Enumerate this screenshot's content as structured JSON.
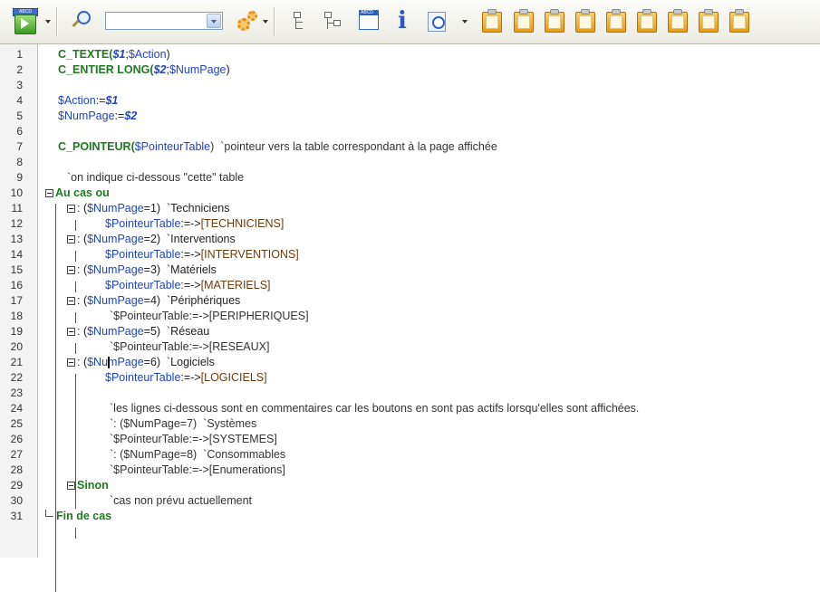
{
  "toolbar": {
    "run_caption": "ABCD",
    "window_caption": "ABCD",
    "method_select_value": "",
    "icons": [
      "run-icon",
      "search-icon",
      "method-list-dropdown",
      "gears-icon",
      "collapse-tree-icon",
      "expand-tree-icon",
      "window-icon",
      "info-icon",
      "timer-icon",
      "clipboard-icon"
    ]
  },
  "editor": {
    "lines": [
      {
        "n": "1",
        "parts": [
          {
            "t": "C_TEXTE(",
            "c": "kw"
          },
          {
            "t": "$1",
            "c": "param"
          },
          {
            "t": ";",
            "c": "txt"
          },
          {
            "t": "$Action",
            "c": "var"
          },
          {
            "t": ")",
            "c": "txt"
          }
        ]
      },
      {
        "n": "2",
        "parts": [
          {
            "t": "C_ENTIER LONG(",
            "c": "kw"
          },
          {
            "t": "$2",
            "c": "param"
          },
          {
            "t": ";",
            "c": "txt"
          },
          {
            "t": "$NumPage",
            "c": "var"
          },
          {
            "t": ")",
            "c": "txt"
          }
        ]
      },
      {
        "n": "3",
        "parts": []
      },
      {
        "n": "4",
        "parts": [
          {
            "t": "$Action",
            "c": "var"
          },
          {
            "t": ":=",
            "c": "txt"
          },
          {
            "t": "$1",
            "c": "param"
          }
        ]
      },
      {
        "n": "5",
        "parts": [
          {
            "t": "$NumPage",
            "c": "var"
          },
          {
            "t": ":=",
            "c": "txt"
          },
          {
            "t": "$2",
            "c": "param"
          }
        ]
      },
      {
        "n": "6",
        "parts": []
      },
      {
        "n": "7",
        "parts": [
          {
            "t": "C_POINTEUR(",
            "c": "kw"
          },
          {
            "t": "$PointeurTable",
            "c": "var"
          },
          {
            "t": ")  `pointeur vers la table correspondant à la page affichée",
            "c": "cmt"
          }
        ]
      },
      {
        "n": "8",
        "parts": []
      },
      {
        "n": "9",
        "parts": [
          {
            "t": "`on indique ci-dessous \"cette\" table",
            "c": "cmt"
          }
        ]
      },
      {
        "n": "10",
        "parts": [
          {
            "t": "Au cas ou",
            "c": "kw"
          }
        ]
      },
      {
        "n": "11",
        "parts": [
          {
            "t": ": (",
            "c": "txt"
          },
          {
            "t": "$NumPage",
            "c": "var"
          },
          {
            "t": "=1)  `Techniciens",
            "c": "txt"
          }
        ]
      },
      {
        "n": "12",
        "parts": [
          {
            "t": "$PointeurTable",
            "c": "var"
          },
          {
            "t": ":=->",
            "c": "txt"
          },
          {
            "t": "[TECHNICIENS]",
            "c": "tbl"
          }
        ]
      },
      {
        "n": "13",
        "parts": [
          {
            "t": ": (",
            "c": "txt"
          },
          {
            "t": "$NumPage",
            "c": "var"
          },
          {
            "t": "=2)  `Interventions",
            "c": "txt"
          }
        ]
      },
      {
        "n": "14",
        "parts": [
          {
            "t": "$PointeurTable",
            "c": "var"
          },
          {
            "t": ":=->",
            "c": "txt"
          },
          {
            "t": "[INTERVENTIONS]",
            "c": "tbl"
          }
        ]
      },
      {
        "n": "15",
        "parts": [
          {
            "t": ": (",
            "c": "txt"
          },
          {
            "t": "$NumPage",
            "c": "var"
          },
          {
            "t": "=3)  `Matériels",
            "c": "txt"
          }
        ]
      },
      {
        "n": "16",
        "parts": [
          {
            "t": "$PointeurTable",
            "c": "var"
          },
          {
            "t": ":=->",
            "c": "txt"
          },
          {
            "t": "[MATERIELS]",
            "c": "tbl"
          }
        ]
      },
      {
        "n": "17",
        "parts": [
          {
            "t": ": (",
            "c": "txt"
          },
          {
            "t": "$NumPage",
            "c": "var"
          },
          {
            "t": "=4)  `Périphériques",
            "c": "txt"
          }
        ]
      },
      {
        "n": "18",
        "parts": [
          {
            "t": "`$PointeurTable:=->[PERIPHERIQUES]",
            "c": "cmt"
          }
        ]
      },
      {
        "n": "19",
        "parts": [
          {
            "t": ": (",
            "c": "txt"
          },
          {
            "t": "$NumPage",
            "c": "var"
          },
          {
            "t": "=5)  `Réseau",
            "c": "txt"
          }
        ]
      },
      {
        "n": "20",
        "parts": [
          {
            "t": "`$PointeurTable:=->[RESEAUX]",
            "c": "cmt"
          }
        ]
      },
      {
        "n": "21",
        "parts": [
          {
            "t": ": (",
            "c": "txt"
          },
          {
            "t": "$NumPage",
            "c": "var"
          },
          {
            "t": "=6)  `Logiciels",
            "c": "txt"
          }
        ]
      },
      {
        "n": "22",
        "parts": [
          {
            "t": "$PointeurTable",
            "c": "var"
          },
          {
            "t": ":=->",
            "c": "txt"
          },
          {
            "t": "[LOGICIELS]",
            "c": "tbl"
          }
        ]
      },
      {
        "n": "23",
        "parts": []
      },
      {
        "n": "24",
        "parts": [
          {
            "t": "`les lignes ci-dessous sont en commentaires car les boutons en sont pas actifs lorsqu'elles sont affichées.",
            "c": "cmt"
          }
        ]
      },
      {
        "n": "25",
        "parts": [
          {
            "t": "`: ($NumPage=7)  `Systèmes",
            "c": "cmt"
          }
        ]
      },
      {
        "n": "26",
        "parts": [
          {
            "t": "`$PointeurTable:=->[SYSTEMES]",
            "c": "cmt"
          }
        ]
      },
      {
        "n": "27",
        "parts": [
          {
            "t": "`: ($NumPage=8)  `Consommables",
            "c": "cmt"
          }
        ]
      },
      {
        "n": "28",
        "parts": [
          {
            "t": "`$PointeurTable:=->[Enumerations]",
            "c": "cmt"
          }
        ]
      },
      {
        "n": "29",
        "parts": [
          {
            "t": "Sinon",
            "c": "kw"
          }
        ]
      },
      {
        "n": "30",
        "parts": [
          {
            "t": "`cas non prévu actuellement",
            "c": "cmt"
          }
        ]
      },
      {
        "n": "31",
        "parts": [
          {
            "t": "Fin de cas",
            "c": "kw"
          }
        ]
      }
    ]
  }
}
